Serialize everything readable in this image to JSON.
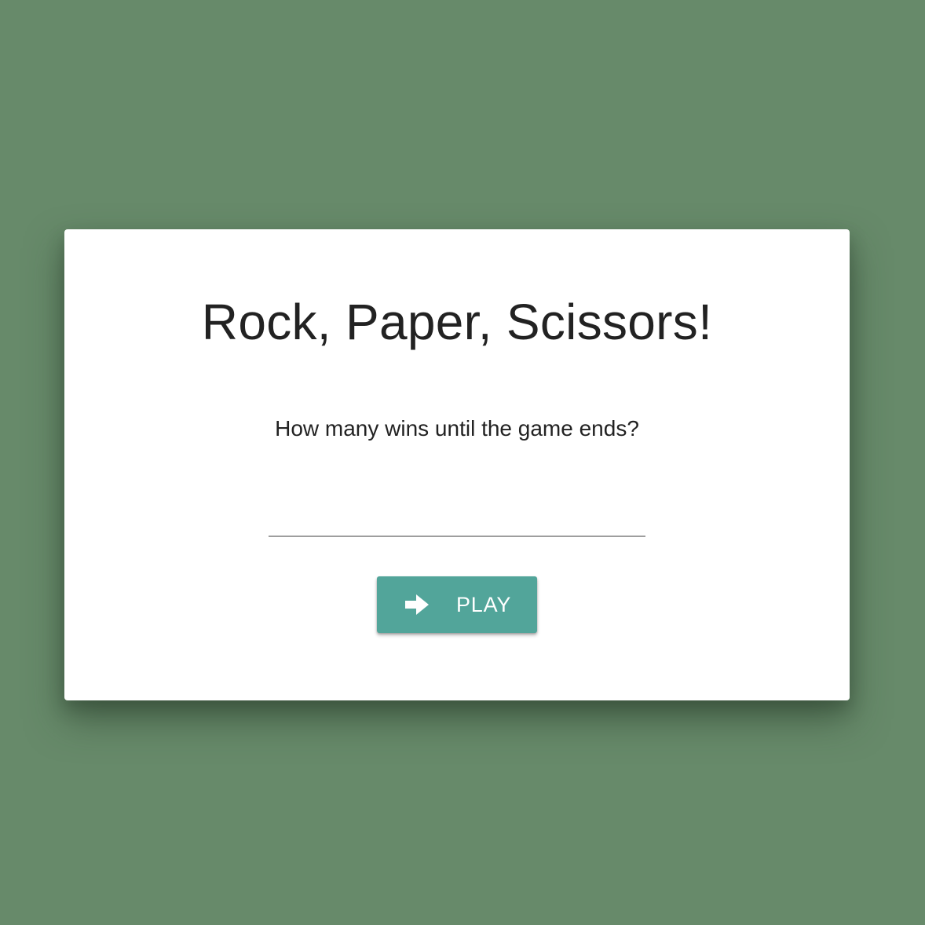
{
  "colors": {
    "background": "#678a6a",
    "card": "#ffffff",
    "accent": "#52a59a",
    "text": "#222222",
    "input_underline": "#9e9e9e"
  },
  "card": {
    "title": "Rock, Paper, Scissors!",
    "question": "How many wins until the game ends?",
    "wins_input": {
      "value": "",
      "placeholder": ""
    },
    "play_button": {
      "icon": "arrow-right-icon",
      "label": "PLAY"
    }
  }
}
